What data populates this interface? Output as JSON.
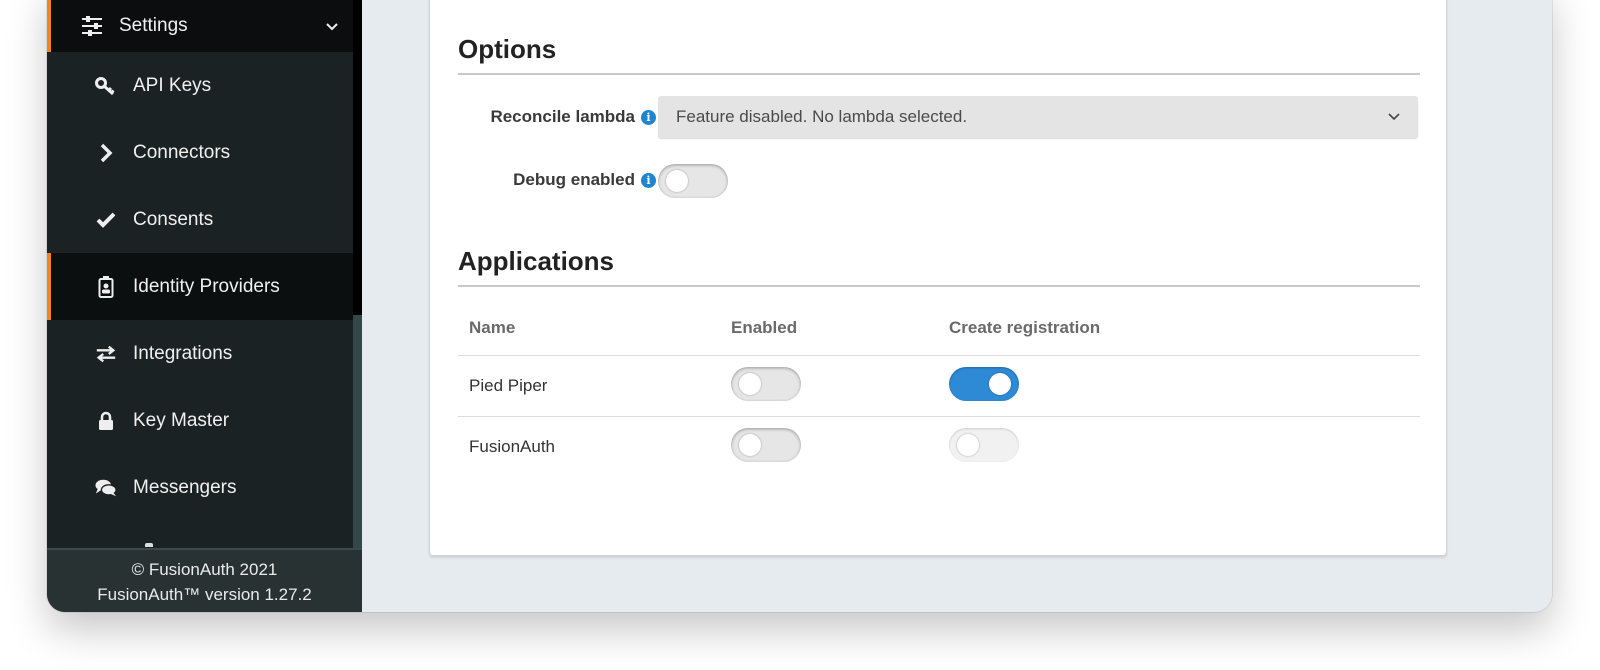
{
  "sidebar": {
    "parent": {
      "label": "Settings",
      "icon": "sliders-icon",
      "expanded": true
    },
    "items": [
      {
        "label": "API Keys",
        "icon": "key-icon",
        "active": false
      },
      {
        "label": "Connectors",
        "icon": "chevron-right-icon",
        "active": false
      },
      {
        "label": "Consents",
        "icon": "check-icon",
        "active": false
      },
      {
        "label": "Identity Providers",
        "icon": "id-badge-icon",
        "active": true
      },
      {
        "label": "Integrations",
        "icon": "exchange-icon",
        "active": false
      },
      {
        "label": "Key Master",
        "icon": "lock-icon",
        "active": false
      },
      {
        "label": "Messengers",
        "icon": "comments-icon",
        "active": false
      }
    ],
    "footer": {
      "copyright": "© FusionAuth 2021",
      "version": "FusionAuth™ version 1.27.2"
    }
  },
  "options": {
    "title": "Options",
    "reconcile_lambda": {
      "label": "Reconcile lambda",
      "value": "Feature disabled. No lambda selected."
    },
    "debug_enabled": {
      "label": "Debug enabled",
      "on": false
    }
  },
  "applications": {
    "title": "Applications",
    "columns": [
      "Name",
      "Enabled",
      "Create registration"
    ],
    "rows": [
      {
        "name": "Pied Piper",
        "enabled": false,
        "create_registration": true
      },
      {
        "name": "FusionAuth",
        "enabled": false,
        "create_registration": false,
        "create_registration_disabled": true
      }
    ]
  },
  "colors": {
    "accent": "#f58320",
    "toggle_on": "#2f8ad6",
    "info": "#1e86d0",
    "sidebar_bg": "#1b2223",
    "page_bg": "#e6ebef"
  }
}
